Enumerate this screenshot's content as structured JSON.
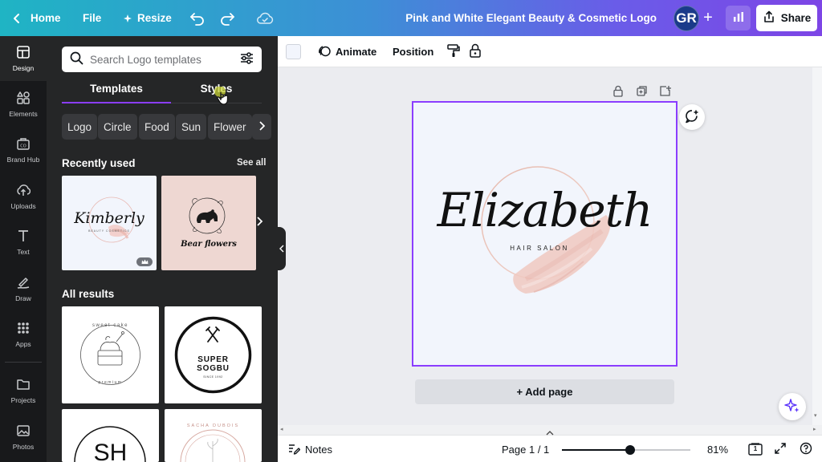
{
  "topbar": {
    "home_label": "Home",
    "file_label": "File",
    "resize_label": "Resize",
    "document_title": "Pink and White Elegant Beauty & Cosmetic Logo",
    "avatar_initials": "GR",
    "share_label": "Share"
  },
  "rail": {
    "items": [
      {
        "label": "Design",
        "icon": "design-icon"
      },
      {
        "label": "Elements",
        "icon": "elements-icon"
      },
      {
        "label": "Brand Hub",
        "icon": "brand-hub-icon"
      },
      {
        "label": "Uploads",
        "icon": "upload-icon"
      },
      {
        "label": "Text",
        "icon": "text-icon"
      },
      {
        "label": "Draw",
        "icon": "draw-icon"
      },
      {
        "label": "Apps",
        "icon": "apps-icon"
      },
      {
        "label": "Projects",
        "icon": "folder-icon"
      },
      {
        "label": "Photos",
        "icon": "photos-icon"
      }
    ]
  },
  "panel": {
    "search_placeholder": "Search Logo templates",
    "tabs": [
      {
        "label": "Templates",
        "active": true
      },
      {
        "label": "Styles",
        "active": false
      }
    ],
    "chips": [
      "Logo",
      "Circle",
      "Food",
      "Sun",
      "Flower"
    ],
    "recently_used_label": "Recently used",
    "see_all_label": "See all",
    "all_results_label": "All results",
    "recent_thumbs": [
      {
        "script": "Kimberly",
        "sub": "BEAUTY COSMETICS"
      },
      {
        "script": "Bear flowers"
      }
    ],
    "result_thumbs": [
      {
        "top_text": "sweet cake",
        "bottom_text": "premium"
      },
      {
        "line1": "SUPER",
        "line2": "SOGBU",
        "line3": "SINCE 1992"
      },
      {
        "monogram": "SH"
      },
      {
        "ring_text": "SACHA DUBOIS"
      }
    ]
  },
  "context_bar": {
    "swatch_color": "#f2f5fc",
    "animate_label": "Animate",
    "position_label": "Position"
  },
  "canvas": {
    "logo_script": "Elizabeth",
    "logo_subtitle": "HAIR SALON",
    "add_page_label": "+ Add page",
    "accent_color": "#8b3dff"
  },
  "bottom_bar": {
    "notes_label": "Notes",
    "page_label": "Page 1 / 1",
    "zoom_label": "81%",
    "zoom_fraction": 0.53,
    "page_count_badge": "1"
  }
}
